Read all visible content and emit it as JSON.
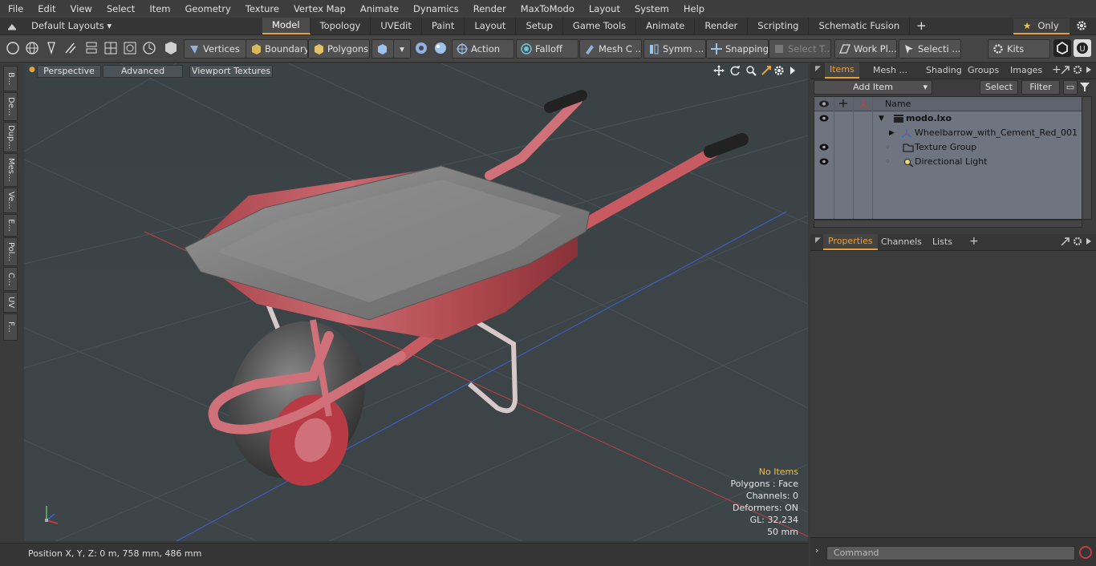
{
  "menu": [
    "File",
    "Edit",
    "View",
    "Select",
    "Item",
    "Geometry",
    "Texture",
    "Vertex Map",
    "Animate",
    "Dynamics",
    "Render",
    "MaxToModo",
    "Layout",
    "System",
    "Help"
  ],
  "layouts": {
    "selector": "Default Layouts"
  },
  "tabs": [
    {
      "label": "Model",
      "active": true
    },
    {
      "label": "Topology"
    },
    {
      "label": "UVEdit"
    },
    {
      "label": "Paint"
    },
    {
      "label": "Layout"
    },
    {
      "label": "Setup"
    },
    {
      "label": "Game Tools"
    },
    {
      "label": "Animate"
    },
    {
      "label": "Render"
    },
    {
      "label": "Scripting"
    },
    {
      "label": "Schematic Fusion"
    }
  ],
  "only_label": "Only",
  "toolbar": {
    "vertices": "Vertices",
    "boundary": "Boundary",
    "polygons": "Polygons",
    "action": "Action",
    "falloff": "Falloff",
    "mesh": "Mesh C ...",
    "symm": "Symm ...",
    "snapping": "Snapping",
    "select_t": "Select T...",
    "workpl": "Work Pl...",
    "selecti": "Selecti ...",
    "kits": "Kits"
  },
  "leftstrip": [
    "B...",
    "De...",
    "Dup...",
    "Mes...",
    "Ve...",
    "E...",
    "Pol...",
    "C...",
    "UV",
    "F..."
  ],
  "viewport": {
    "perspective": "Perspective",
    "advanced": "Advanced",
    "textures": "Viewport Textures",
    "info": {
      "no_items": "No Items",
      "polygons": "Polygons : Face",
      "channels": "Channels: 0",
      "deformers": "Deformers: ON",
      "gl": "GL: 32,234",
      "scale": "50 mm"
    }
  },
  "status": {
    "position": "Position X, Y, Z:   0 m, 758 mm, 486 mm"
  },
  "items_panel": {
    "tabs": [
      "Items",
      "Mesh ...",
      "Shading",
      "Groups",
      "Images"
    ],
    "add_item": "Add Item",
    "select": "Select",
    "filter": "Filter",
    "name_header": "Name",
    "rows": [
      {
        "label": "modo.lxo",
        "eye": true
      },
      {
        "label": "Wheelbarrow_with_Cement_Red_001",
        "eye": false
      },
      {
        "label": "Texture Group",
        "eye": true
      },
      {
        "label": "Directional Light",
        "eye": true
      }
    ]
  },
  "props_panel": {
    "tabs": [
      "Properties",
      "Channels",
      "Lists"
    ]
  },
  "command": {
    "placeholder": "Command"
  },
  "colors": {
    "accent": "#e8a23a",
    "viewport_bg": "#3b4348",
    "list_bg": "#6e7480"
  }
}
